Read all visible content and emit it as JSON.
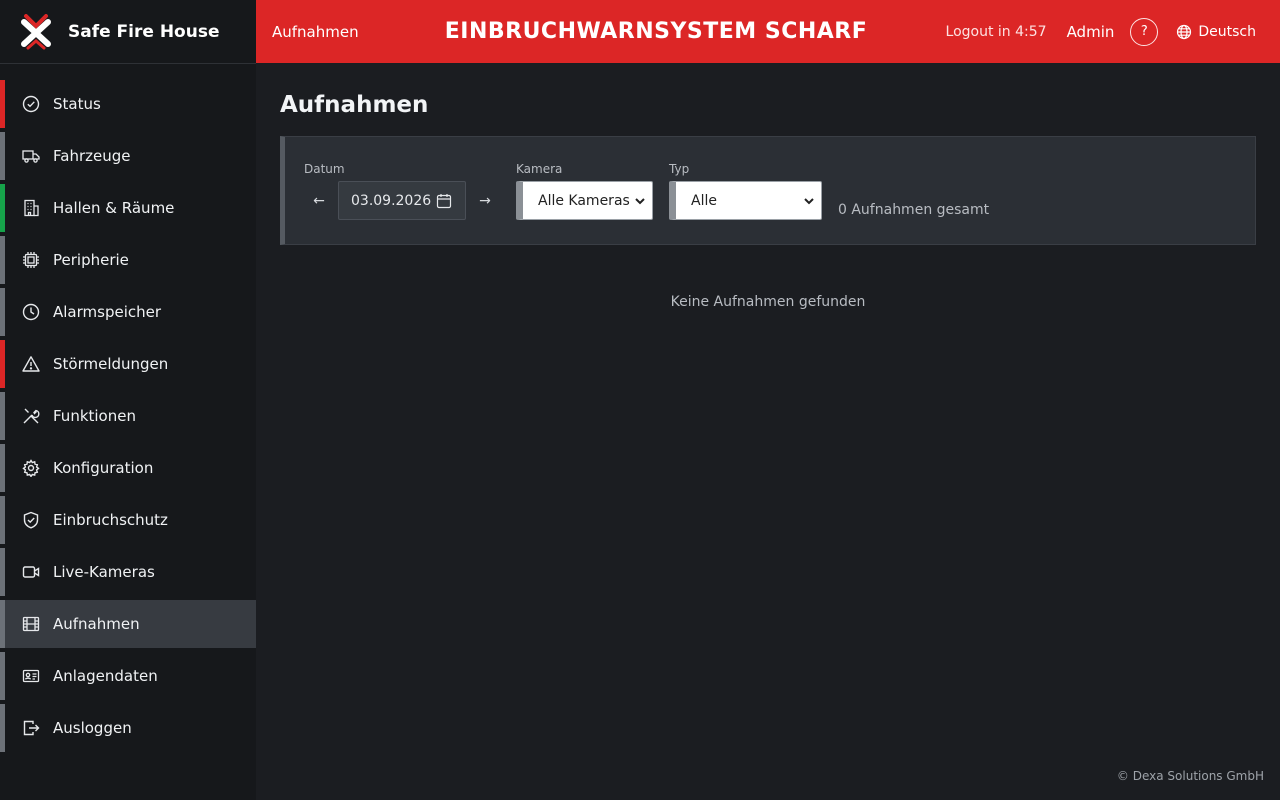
{
  "brand": {
    "name": "Safe Fire House"
  },
  "header": {
    "breadcrumb": "Aufnahmen",
    "title": "EINBRUCHWARNSYSTEM SCHARF",
    "logout_timer": "Logout in 4:57",
    "user": "Admin",
    "help": "?",
    "language": "Deutsch"
  },
  "sidebar": {
    "items": [
      {
        "label": "Status",
        "icon": "check-circle-icon",
        "status": "red"
      },
      {
        "label": "Fahrzeuge",
        "icon": "truck-icon",
        "status": "gray"
      },
      {
        "label": "Hallen & Räume",
        "icon": "building-icon",
        "status": "green"
      },
      {
        "label": "Peripherie",
        "icon": "chip-icon",
        "status": "gray"
      },
      {
        "label": "Alarmspeicher",
        "icon": "clock-icon",
        "status": "gray"
      },
      {
        "label": "Störmeldungen",
        "icon": "warning-icon",
        "status": "red"
      },
      {
        "label": "Funktionen",
        "icon": "tools-icon",
        "status": "gray"
      },
      {
        "label": "Konfiguration",
        "icon": "gear-icon",
        "status": "gray"
      },
      {
        "label": "Einbruchschutz",
        "icon": "shield-check-icon",
        "status": "gray"
      },
      {
        "label": "Live-Kameras",
        "icon": "video-camera-icon",
        "status": "gray"
      },
      {
        "label": "Aufnahmen",
        "icon": "film-icon",
        "status": "gray",
        "active": true
      },
      {
        "label": "Anlagendaten",
        "icon": "id-card-icon",
        "status": "gray"
      },
      {
        "label": "Ausloggen",
        "icon": "logout-icon",
        "status": "gray"
      }
    ]
  },
  "main": {
    "title": "Aufnahmen",
    "filters": {
      "date_label": "Datum",
      "date_prev": "←",
      "date_value": "03.09.2026",
      "date_next": "→",
      "camera_label": "Kamera",
      "camera_value": "Alle Kameras",
      "type_label": "Typ",
      "type_value": "Alle"
    },
    "count_text": "0 Aufnahmen gesamt",
    "empty_message": "Keine Aufnahmen gefunden"
  },
  "footer": {
    "copyright": "© Dexa Solutions GmbH"
  },
  "colors": {
    "accent": "#dc2626",
    "status_red": "#dc2626",
    "status_green": "#16a34a",
    "status_gray": "#6c7178"
  }
}
